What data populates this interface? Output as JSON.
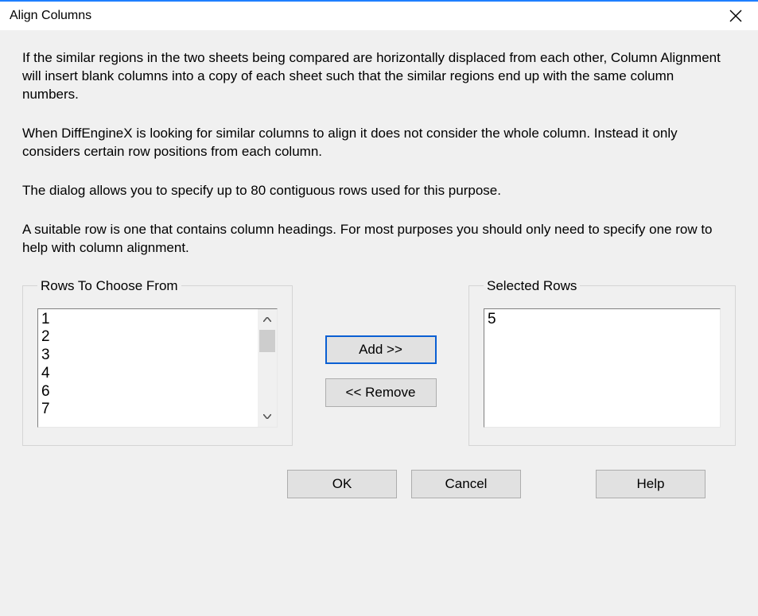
{
  "title": "Align Columns",
  "description": {
    "p1": "If the similar regions in the two sheets being compared are horizontally displaced from each other, Column Alignment will insert blank columns into a copy of each sheet such that the similar regions end up with the same column numbers.",
    "p2": "When DiffEngineX is looking for similar columns to align it does not consider the whole column. Instead it only considers certain row positions from each column.",
    "p3": "The dialog allows you to specify up to 80 contiguous rows used for this purpose.",
    "p4": "A suitable row is one that contains column headings. For most purposes you should only need to specify one row to help with column alignment."
  },
  "groups": {
    "available": {
      "legend": "Rows To Choose From",
      "items": [
        "1",
        "2",
        "3",
        "4",
        "6",
        "7"
      ]
    },
    "selected": {
      "legend": "Selected Rows",
      "items": [
        "5"
      ]
    }
  },
  "buttons": {
    "add": "Add >>",
    "remove": "<< Remove",
    "ok": "OK",
    "cancel": "Cancel",
    "help": "Help"
  }
}
